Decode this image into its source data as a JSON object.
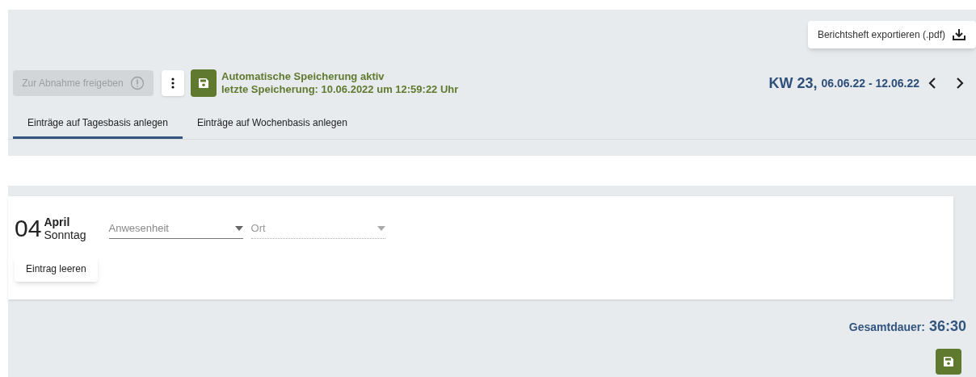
{
  "export_button": {
    "label": "Berichtsheft exportieren (.pdf)"
  },
  "release_button": {
    "label": "Zur Abnahme freigeben",
    "disabled": true
  },
  "autosave": {
    "title": "Automatische Speicherung aktiv",
    "last_saved": "letzte Speicherung: 10.06.2022 um 12:59:22 Uhr"
  },
  "week": {
    "number": "KW 23,",
    "range": "06.06.22 - 12.06.22"
  },
  "tabs": [
    {
      "label": "Einträge auf Tagesbasis anlegen",
      "selected": true
    },
    {
      "label": "Einträge auf Wochenbasis anlegen",
      "selected": false
    }
  ],
  "entry": {
    "day": "04",
    "month": "April",
    "weekday": "Sonntag",
    "fields": [
      {
        "placeholder": "Anwesenheit",
        "disabled": false
      },
      {
        "placeholder": "Ort",
        "disabled": true
      }
    ],
    "clear_button": "Eintrag leeren"
  },
  "total": {
    "label": "Gesamtdauer:",
    "value": "36:30"
  }
}
